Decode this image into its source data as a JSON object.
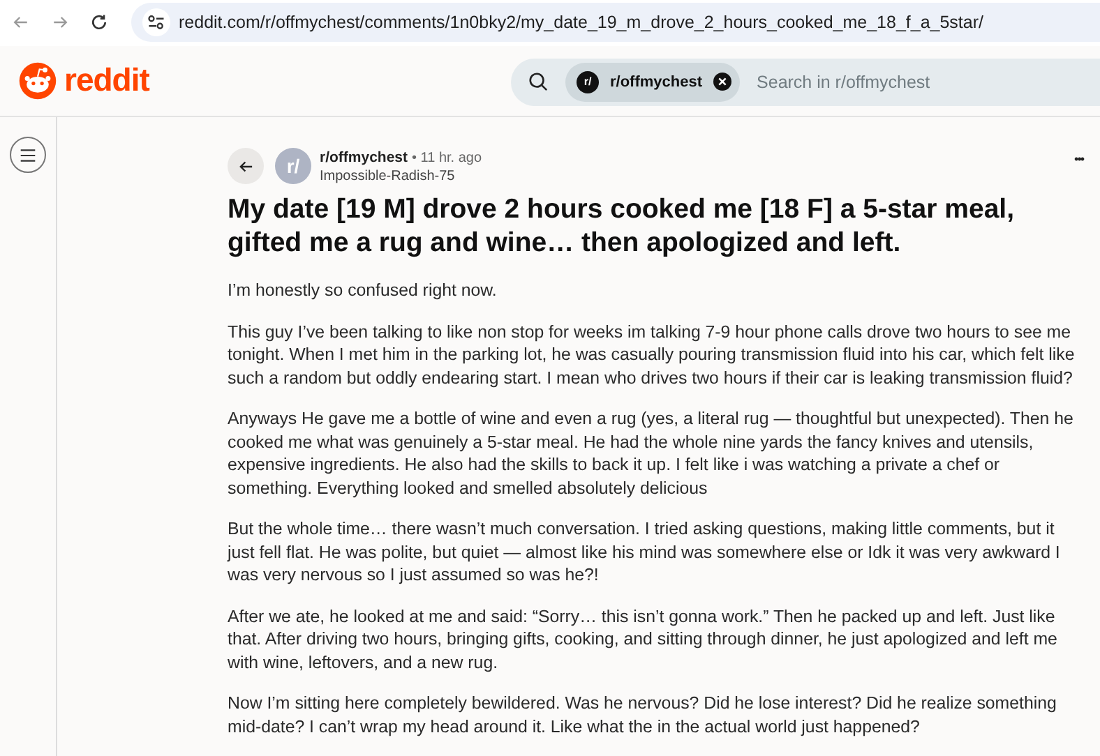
{
  "browser": {
    "url": "reddit.com/r/offmychest/comments/1n0bky2/my_date_19_m_drove_2_hours_cooked_me_18_f_a_5star/"
  },
  "header": {
    "logo": "reddit",
    "search": {
      "chip": "r/offmychest",
      "chip_icon": "r/",
      "placeholder": "Search in r/offmychest"
    }
  },
  "post": {
    "avatar": "r/",
    "subreddit": "r/offmychest",
    "time": "• 11 hr. ago",
    "author": "Impossible-Radish-75",
    "menu": "•••",
    "title": "My date [19 M] drove 2 hours cooked me [18 F] a 5-star meal, gifted me a rug and wine… then apologized and left.",
    "paragraphs": [
      "I’m honestly so confused right now.",
      "This guy I’ve been talking to like non stop for weeks im talking 7-9 hour phone calls drove two hours to see me tonight. When I met him in the parking lot, he was casually pouring transmission fluid into his car, which felt like such a random but oddly endearing start. I mean who drives two hours if their car is leaking transmission fluid?",
      "Anyways He gave me a bottle of wine and even a rug (yes, a literal rug — thoughtful but unexpected). Then he cooked me what was genuinely a 5-star meal. He had the whole nine yards the fancy knives and utensils, expensive ingredients. He also had the skills to back it up. I felt like i was watching a private a chef or something. Everything looked and smelled absolutely delicious",
      "But the whole time… there wasn’t much conversation. I tried asking questions, making little comments, but it just fell flat. He was polite, but quiet — almost like his mind was somewhere else or Idk it was very awkward I was very nervous so I just assumed so was he?!",
      "After we ate, he looked at me and said: “Sorry… this isn’t gonna work.” Then he packed up and left. Just like that. After driving two hours, bringing gifts, cooking, and sitting through dinner, he just apologized and left me with wine, leftovers, and a new rug.",
      "Now I’m sitting here completely bewildered. Was he nervous? Did he lose interest? Did he realize something mid-date? I can’t wrap my head around it. Like what the in the actual world just happened?"
    ]
  }
}
